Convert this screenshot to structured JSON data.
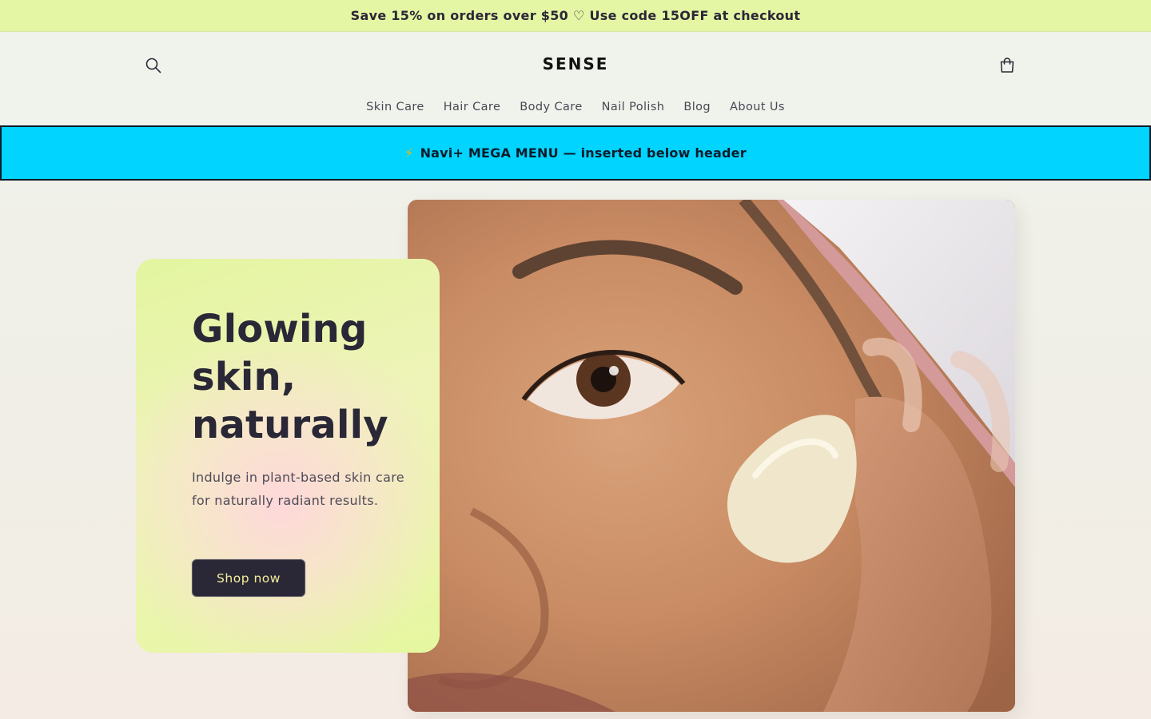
{
  "announcement": {
    "text": "Save 15% on orders over $50 ♡ Use code 15OFF at checkout"
  },
  "header": {
    "logo": "SENSE",
    "search_icon": "search-icon",
    "cart_icon": "cart-icon"
  },
  "nav": {
    "items": [
      {
        "label": "Skin Care"
      },
      {
        "label": "Hair Care"
      },
      {
        "label": "Body Care"
      },
      {
        "label": "Nail Polish"
      },
      {
        "label": "Blog"
      },
      {
        "label": "About Us"
      }
    ]
  },
  "mega_menu": {
    "icon": "⚡",
    "text": "Navi+ MEGA MENU — inserted below header"
  },
  "hero": {
    "title_lines": [
      "Glowing",
      "skin,",
      "naturally"
    ],
    "subtitle": "Indulge in plant-based skin care for naturally radiant results.",
    "button_label": "Shop now",
    "image": "woman-applying-face-cream"
  },
  "colors": {
    "announcement_bg": "#e4f5a4",
    "mega_menu_bg": "#00d4ff",
    "button_bg": "#2a2736",
    "button_text": "#f4ef9c"
  }
}
